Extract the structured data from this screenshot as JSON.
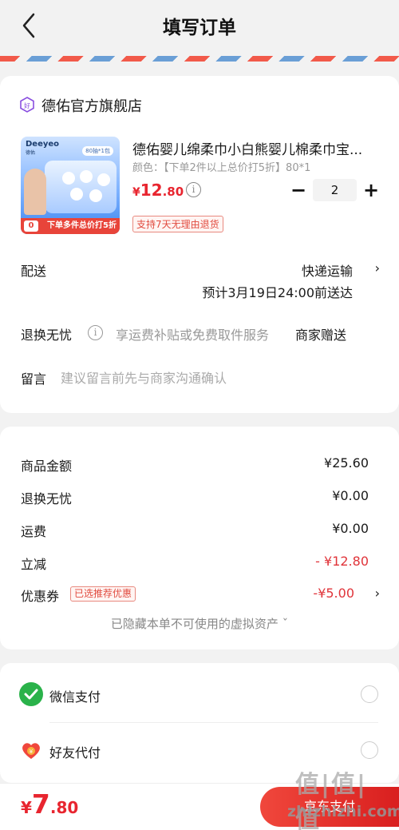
{
  "header": {
    "title": "填写订单",
    "back_icon": "chevron-left-icon"
  },
  "shop": {
    "name": "德佑官方旗舰店",
    "icon": "diamond-shop-icon",
    "icon_color": "#8a4fe0"
  },
  "product": {
    "title": "德佑婴儿绵柔巾小白熊婴儿棉柔巾宝...",
    "spec": "颜色：【下单2件以上总价打5折】80*1",
    "price_currency": "¥",
    "price_int": "12",
    "price_dec": ".80",
    "quantity": "2",
    "return_tag": "支持7天无理由退货",
    "image": {
      "brand": "Deeyeo",
      "brand_sub": "德佑",
      "spec_badge": "80抽*1包",
      "promo_banner": "下单多件总价打5折",
      "promo_zero": "0"
    }
  },
  "delivery": {
    "label": "配送",
    "method": "快递运输",
    "eta": "预计3月19日24:00前送达"
  },
  "worry_free": {
    "label": "退换无忧",
    "desc": "享运费补贴或免费取件服务",
    "gift": "商家赠送"
  },
  "note": {
    "label": "留言",
    "placeholder": "建议留言前先与商家沟通确认"
  },
  "summary": {
    "goods_label": "商品金额",
    "goods_value": "¥25.60",
    "worry_label": "退换无忧",
    "worry_value": "¥0.00",
    "shipping_label": "运费",
    "shipping_value": "¥0.00",
    "discount_label": "立减",
    "discount_value": "- ¥12.80",
    "coupon_label": "优惠券",
    "coupon_tag": "已选推荐优惠",
    "coupon_value": "-¥5.00",
    "hidden_assets": "已隐藏本单不可使用的虚拟资产 ˇ"
  },
  "payment": {
    "wechat_label": "微信支付",
    "wechat_color": "#2ab24a",
    "friend_label": "好友代付",
    "friend_color": "#f0473c"
  },
  "bottom": {
    "total_currency": "¥",
    "total_int": "7",
    "total_dec": ".80",
    "pay_button": "京东支付"
  },
  "watermark": {
    "title": "值|值|值",
    "url": "zhizhizhi.com"
  },
  "colors": {
    "accent_red": "#e8252f",
    "background": "#f2f2f2"
  }
}
